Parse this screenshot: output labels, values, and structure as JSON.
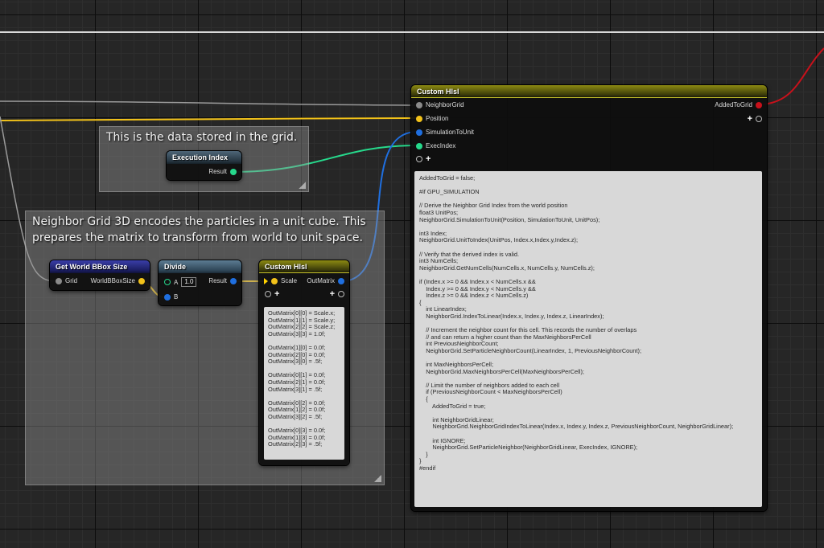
{
  "colors": {
    "exec_white": "#ffffff",
    "float_green": "#26d98c",
    "vector_yellow": "#f2c21a",
    "matrix_blue": "#1f6fe0",
    "bool_red": "#c8111b",
    "struct_grey": "#8a8a8a",
    "header_olive": "#8c8a12"
  },
  "comments": {
    "data_stored": "This is the data stored in the grid.",
    "neighbor_grid_line1": "Neighbor Grid 3D encodes the particles in a unit cube. This",
    "neighbor_grid_line2": "prepares the matrix to transform from world to unit space."
  },
  "nodes": {
    "custom_hlsl_main": {
      "title": "Custom Hlsl",
      "inputs": [
        "NeighborGrid",
        "Position",
        "SimulationToUnit",
        "ExecIndex"
      ],
      "output": "AddedToGrid",
      "add_icon": "plus-icon",
      "code": "AddedToGrid = false;\n\n#if GPU_SIMULATION\n\n// Derive the Neighbor Grid Index from the world position\nfloat3 UnitPos;\nNeighborGrid.SimulationToUnit(Position, SimulationToUnit, UnitPos);\n\nint3 Index;\nNeighborGrid.UnitToIndex(UnitPos, Index.x,Index.y,Index.z);\n\n// Verify that the derived index is valid.\nint3 NumCells;\nNeighborGrid.GetNumCells(NumCells.x, NumCells.y, NumCells.z);\n\nif (Index.x >= 0 && Index.x < NumCells.x &&\n    Index.y >= 0 && Index.y < NumCells.y &&\n    Index.z >= 0 && Index.z < NumCells.z)\n{\n    int LinearIndex;\n    NeighborGrid.IndexToLinear(Index.x, Index.y, Index.z, LinearIndex);\n\n    // Increment the neighbor count for this cell. This records the number of overlaps\n    // and can return a higher count than the MaxNeighborsPerCell\n    int PreviousNeighborCount;\n    NeighborGrid.SetParticleNeighborCount(LinearIndex, 1, PreviousNeighborCount);\n\n    int MaxNeighborsPerCell;\n    NeighborGrid.MaxNeighborsPerCell(MaxNeighborsPerCell);\n\n    // Limit the number of neighbors added to each cell\n    if (PreviousNeighborCount < MaxNeighborsPerCell)\n    {\n        AddedToGrid = true;\n\n        int NeighborGridLinear;\n        NeighborGrid.NeighborGridIndexToLinear(Index.x, Index.y, Index.z, PreviousNeighborCount, NeighborGridLinear);\n\n        int IGNORE;\n        NeighborGrid.SetParticleNeighbor(NeighborGridLinear, ExecIndex, IGNORE);\n    }\n}\n#endif"
    },
    "execution_index": {
      "title": "Execution Index",
      "output": "Result"
    },
    "get_world_bbox": {
      "title": "Get World BBox Size",
      "input": "Grid",
      "output": "WorldBBoxSize"
    },
    "divide": {
      "title": "Divide",
      "input_a_label": "A",
      "input_a_value": "1.0",
      "input_b_label": "B",
      "output": "Result"
    },
    "custom_hlsl_matrix": {
      "title": "Custom Hlsl",
      "input": "Scale",
      "output": "OutMatrix",
      "code": "OutMatrix[0][0] = Scale.x;\nOutMatrix[1][1] = Scale.y;\nOutMatrix[2][2] = Scale.z;\nOutMatrix[3][3] = 1.0f;\n\nOutMatrix[1][0] = 0.0f;\nOutMatrix[2][0] = 0.0f;\nOutMatrix[3][0] = .5f;\n\nOutMatrix[0][1] = 0.0f;\nOutMatrix[2][1] = 0.0f;\nOutMatrix[3][1] = .5f;\n\nOutMatrix[0][2] = 0.0f;\nOutMatrix[1][2] = 0.0f;\nOutMatrix[3][2] = .5f;\n\nOutMatrix[0][3] = 0.0f;\nOutMatrix[1][3] = 0.0f;\nOutMatrix[2][3] = .5f;"
    }
  }
}
